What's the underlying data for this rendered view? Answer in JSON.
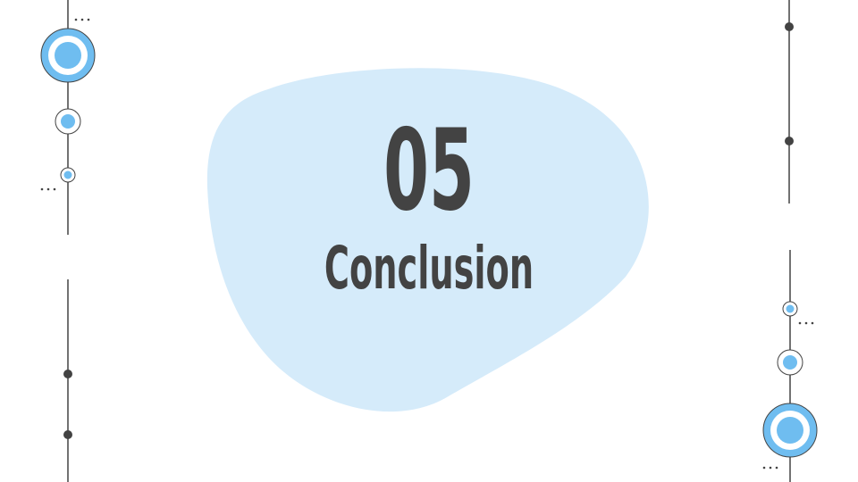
{
  "slide": {
    "number": "05",
    "title": "Conclusion"
  },
  "colors": {
    "blob": "#d5ebfa",
    "accent": "#6fbdf0",
    "ink": "#434343",
    "ring_fill": "#ffffff"
  },
  "decorations": {
    "ellipsis_glyph": "…"
  }
}
